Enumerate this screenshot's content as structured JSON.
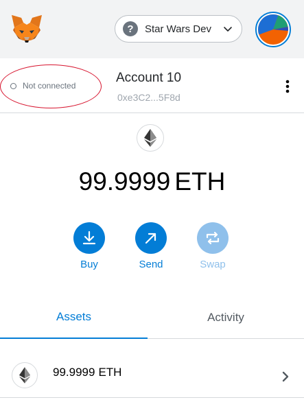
{
  "header": {
    "network": {
      "label": "Star Wars Dev",
      "icon": "question-icon"
    },
    "logo": "metamask-fox-logo",
    "avatar": "account-identicon"
  },
  "account": {
    "connection_status": "Not connected",
    "name": "Account 10",
    "address": "0xe3C2...5F8d",
    "menu_icon": "kebab-menu-icon"
  },
  "balance": {
    "amount": "99.9999",
    "unit": "ETH"
  },
  "actions": [
    {
      "label": "Buy",
      "icon": "download-icon",
      "enabled": true
    },
    {
      "label": "Send",
      "icon": "arrow-up-right-icon",
      "enabled": true
    },
    {
      "label": "Swap",
      "icon": "swap-icon",
      "enabled": false
    }
  ],
  "tabs": [
    {
      "label": "Assets",
      "active": true
    },
    {
      "label": "Activity",
      "active": false
    }
  ],
  "assets": [
    {
      "amount": "99.9999",
      "unit": "ETH",
      "icon": "ethereum-icon"
    }
  ],
  "colors": {
    "primary": "#037dd6",
    "disabled": "#8fc0eb",
    "header_bg": "#f2f3f4",
    "annotation": "#d7142e"
  }
}
